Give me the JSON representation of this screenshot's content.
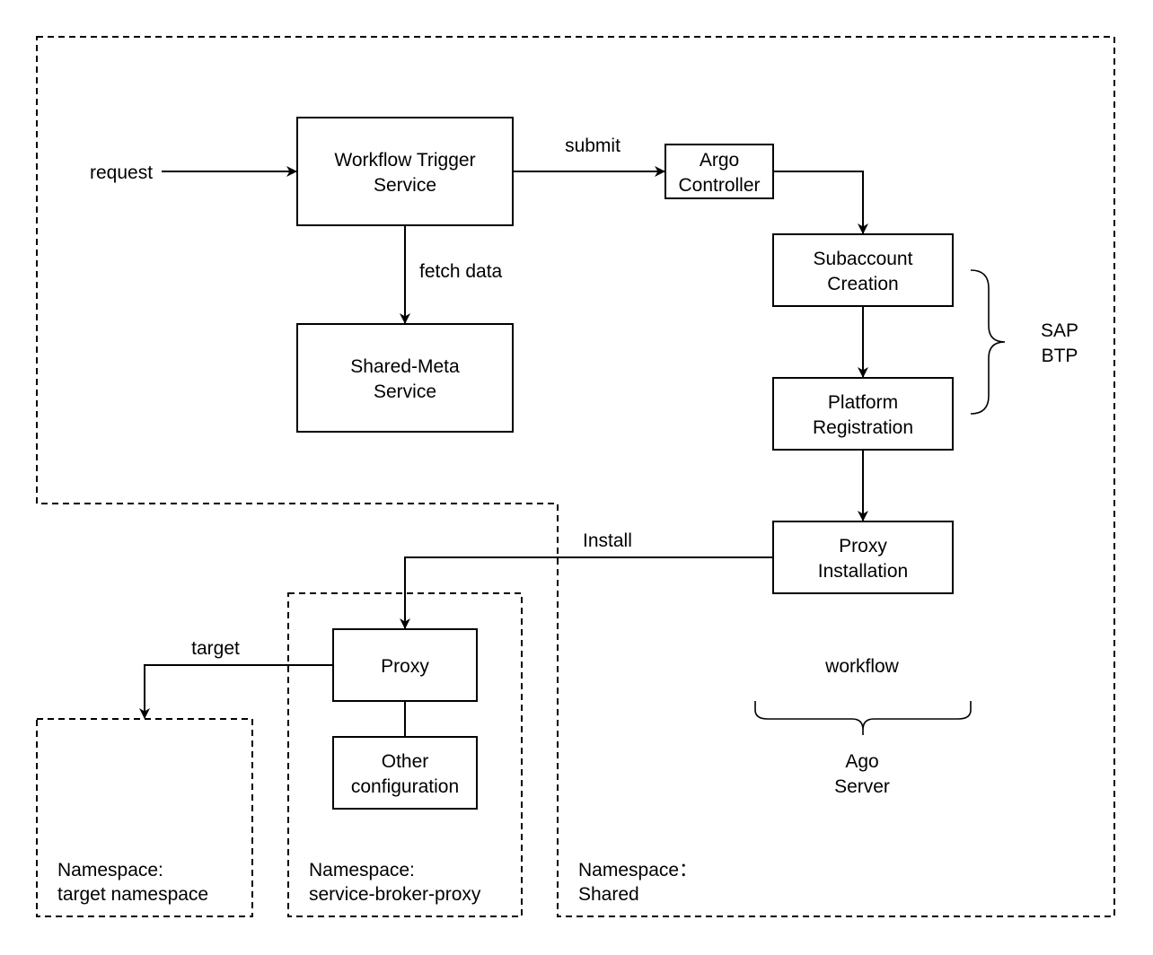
{
  "diagram": {
    "colors": {
      "stroke": "#000000",
      "background": "#ffffff",
      "text": "#000000"
    },
    "regions": {
      "shared": {
        "label_line1": "Namespace：",
        "label_line2": "Shared"
      },
      "service_broker_proxy": {
        "label_line1": "Namespace:",
        "label_line2": "service-broker-proxy"
      },
      "target": {
        "label_line1": "Namespace:",
        "label_line2": "target namespace"
      }
    },
    "nodes": {
      "workflow_trigger": {
        "line1": "Workflow Trigger",
        "line2": "Service"
      },
      "shared_meta": {
        "line1": "Shared-Meta",
        "line2": "Service"
      },
      "argo_controller": {
        "line1": "Argo",
        "line2": "Controller"
      },
      "subaccount_creation": {
        "line1": "Subaccount",
        "line2": "Creation"
      },
      "platform_registration": {
        "line1": "Platform",
        "line2": "Registration"
      },
      "proxy_installation": {
        "line1": "Proxy",
        "line2": "Installation"
      },
      "proxy": {
        "line1": "Proxy"
      },
      "other_configuration": {
        "line1": "Other",
        "line2": "configuration"
      }
    },
    "edges": {
      "request": "request",
      "submit": "submit",
      "fetch_data": "fetch data",
      "install": "Install",
      "target": "target"
    },
    "annotations": {
      "sap_btp": {
        "line1": "SAP",
        "line2": "BTP"
      },
      "workflow": "workflow",
      "ago_server": {
        "line1": "Ago",
        "line2": "Server"
      }
    }
  }
}
